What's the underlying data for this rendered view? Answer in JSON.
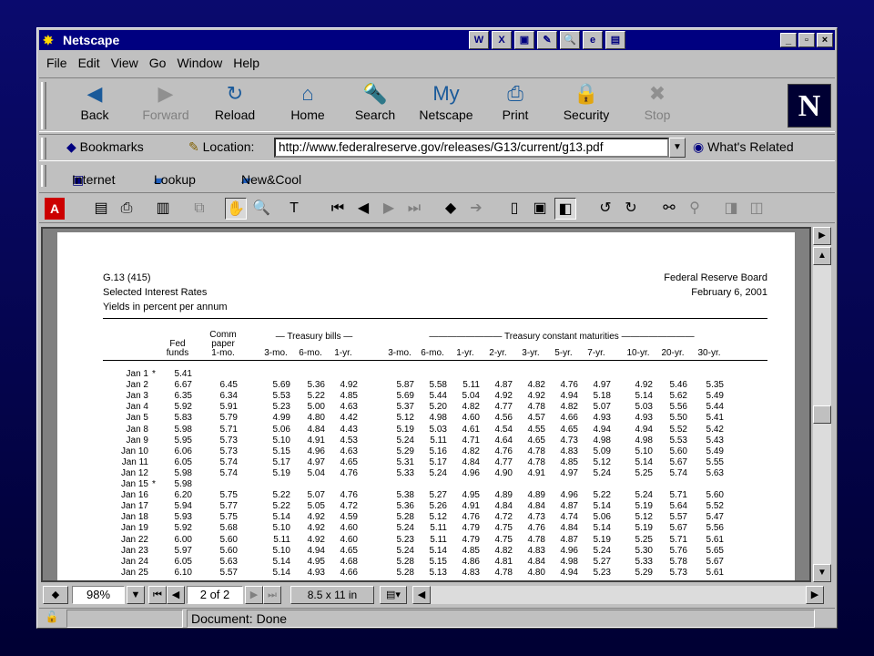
{
  "window": {
    "title": "Netscape",
    "tray_icons": [
      "W",
      "X",
      "▣",
      "✎",
      "🔍",
      "e",
      "▤"
    ],
    "buttons": [
      "_",
      "▫",
      "×"
    ]
  },
  "menu": [
    "File",
    "Edit",
    "View",
    "Go",
    "Window",
    "Help"
  ],
  "nav": [
    {
      "label": "Back",
      "icon": "◀",
      "enabled": true
    },
    {
      "label": "Forward",
      "icon": "▶",
      "enabled": false
    },
    {
      "label": "Reload",
      "icon": "↻",
      "enabled": true
    },
    {
      "label": "Home",
      "icon": "⌂",
      "enabled": true
    },
    {
      "label": "Search",
      "icon": "🔦",
      "enabled": true
    },
    {
      "label": "Netscape",
      "icon": "My",
      "enabled": true
    },
    {
      "label": "Print",
      "icon": "⎙",
      "enabled": true
    },
    {
      "label": "Security",
      "icon": "🔒",
      "enabled": true
    },
    {
      "label": "Stop",
      "icon": "✖",
      "enabled": false
    }
  ],
  "logo": "N",
  "location": {
    "bookmarks": "Bookmarks",
    "label": "Location:",
    "url": "http://www.federalreserve.gov/releases/G13/current/g13.pdf",
    "related": "What's Related"
  },
  "personal": [
    "Internet",
    "Lookup",
    "New&Cool"
  ],
  "pdf_toolbar": {
    "adobe": "A"
  },
  "doc": {
    "header_left": [
      "G.13 (415)",
      "Selected Interest Rates",
      "Yields in percent per annum"
    ],
    "header_right": [
      "Federal Reserve Board",
      "February 6, 2001"
    ],
    "group_treasury_bills": "Treasury bills",
    "group_constant": "Treasury constant maturities",
    "columns": [
      {
        "label": "Fed\nfunds"
      },
      {
        "label": "Comm\npaper\n1-mo."
      },
      {
        "label": "3-mo."
      },
      {
        "label": "6-mo."
      },
      {
        "label": "1-yr."
      },
      {
        "label": "3-mo."
      },
      {
        "label": "6-mo."
      },
      {
        "label": "1-yr."
      },
      {
        "label": "2-yr."
      },
      {
        "label": "3-yr."
      },
      {
        "label": "5-yr."
      },
      {
        "label": "7-yr."
      },
      {
        "label": "10-yr."
      },
      {
        "label": "20-yr."
      },
      {
        "label": "30-yr."
      }
    ],
    "rows": [
      {
        "date": "Jan 1",
        "star": "*",
        "v": [
          "5.41",
          "",
          "",
          "",
          "",
          "",
          "",
          "",
          "",
          "",
          "",
          "",
          "",
          "",
          ""
        ]
      },
      {
        "date": "Jan 2",
        "star": "",
        "v": [
          "6.67",
          "6.45",
          "5.69",
          "5.36",
          "4.92",
          "5.87",
          "5.58",
          "5.11",
          "4.87",
          "4.82",
          "4.76",
          "4.97",
          "4.92",
          "5.46",
          "5.35"
        ]
      },
      {
        "date": "Jan 3",
        "star": "",
        "v": [
          "6.35",
          "6.34",
          "5.53",
          "5.22",
          "4.85",
          "5.69",
          "5.44",
          "5.04",
          "4.92",
          "4.92",
          "4.94",
          "5.18",
          "5.14",
          "5.62",
          "5.49"
        ]
      },
      {
        "date": "Jan 4",
        "star": "",
        "v": [
          "5.92",
          "5.91",
          "5.23",
          "5.00",
          "4.63",
          "5.37",
          "5.20",
          "4.82",
          "4.77",
          "4.78",
          "4.82",
          "5.07",
          "5.03",
          "5.56",
          "5.44"
        ]
      },
      {
        "date": "Jan 5",
        "star": "",
        "v": [
          "5.83",
          "5.79",
          "4.99",
          "4.80",
          "4.42",
          "5.12",
          "4.98",
          "4.60",
          "4.56",
          "4.57",
          "4.66",
          "4.93",
          "4.93",
          "5.50",
          "5.41"
        ]
      },
      {
        "date": "Jan 8",
        "star": "",
        "v": [
          "5.98",
          "5.71",
          "5.06",
          "4.84",
          "4.43",
          "5.19",
          "5.03",
          "4.61",
          "4.54",
          "4.55",
          "4.65",
          "4.94",
          "4.94",
          "5.52",
          "5.42"
        ]
      },
      {
        "date": "Jan 9",
        "star": "",
        "v": [
          "5.95",
          "5.73",
          "5.10",
          "4.91",
          "4.53",
          "5.24",
          "5.11",
          "4.71",
          "4.64",
          "4.65",
          "4.73",
          "4.98",
          "4.98",
          "5.53",
          "5.43"
        ]
      },
      {
        "date": "Jan 10",
        "star": "",
        "v": [
          "6.06",
          "5.73",
          "5.15",
          "4.96",
          "4.63",
          "5.29",
          "5.16",
          "4.82",
          "4.76",
          "4.78",
          "4.83",
          "5.09",
          "5.10",
          "5.60",
          "5.49"
        ]
      },
      {
        "date": "Jan 11",
        "star": "",
        "v": [
          "6.05",
          "5.74",
          "5.17",
          "4.97",
          "4.65",
          "5.31",
          "5.17",
          "4.84",
          "4.77",
          "4.78",
          "4.85",
          "5.12",
          "5.14",
          "5.67",
          "5.55"
        ]
      },
      {
        "date": "Jan 12",
        "star": "",
        "v": [
          "5.98",
          "5.74",
          "5.19",
          "5.04",
          "4.76",
          "5.33",
          "5.24",
          "4.96",
          "4.90",
          "4.91",
          "4.97",
          "5.24",
          "5.25",
          "5.74",
          "5.63"
        ]
      },
      {
        "date": "Jan 15",
        "star": "*",
        "v": [
          "5.98",
          "",
          "",
          "",
          "",
          "",
          "",
          "",
          "",
          "",
          "",
          "",
          "",
          "",
          ""
        ]
      },
      {
        "date": "Jan 16",
        "star": "",
        "v": [
          "6.20",
          "5.75",
          "5.22",
          "5.07",
          "4.76",
          "5.38",
          "5.27",
          "4.95",
          "4.89",
          "4.89",
          "4.96",
          "5.22",
          "5.24",
          "5.71",
          "5.60"
        ]
      },
      {
        "date": "Jan 17",
        "star": "",
        "v": [
          "5.94",
          "5.77",
          "5.22",
          "5.05",
          "4.72",
          "5.36",
          "5.26",
          "4.91",
          "4.84",
          "4.84",
          "4.87",
          "5.14",
          "5.19",
          "5.64",
          "5.52"
        ]
      },
      {
        "date": "Jan 18",
        "star": "",
        "v": [
          "5.93",
          "5.75",
          "5.14",
          "4.92",
          "4.59",
          "5.28",
          "5.12",
          "4.76",
          "4.72",
          "4.73",
          "4.74",
          "5.06",
          "5.12",
          "5.57",
          "5.47"
        ]
      },
      {
        "date": "Jan 19",
        "star": "",
        "v": [
          "5.92",
          "5.68",
          "5.10",
          "4.92",
          "4.60",
          "5.24",
          "5.11",
          "4.79",
          "4.75",
          "4.76",
          "4.84",
          "5.14",
          "5.19",
          "5.67",
          "5.56"
        ]
      },
      {
        "date": "Jan 22",
        "star": "",
        "v": [
          "6.00",
          "5.60",
          "5.11",
          "4.92",
          "4.60",
          "5.23",
          "5.11",
          "4.79",
          "4.75",
          "4.78",
          "4.87",
          "5.19",
          "5.25",
          "5.71",
          "5.61"
        ]
      },
      {
        "date": "Jan 23",
        "star": "",
        "v": [
          "5.97",
          "5.60",
          "5.10",
          "4.94",
          "4.65",
          "5.24",
          "5.14",
          "4.85",
          "4.82",
          "4.83",
          "4.96",
          "5.24",
          "5.30",
          "5.76",
          "5.65"
        ]
      },
      {
        "date": "Jan 24",
        "star": "",
        "v": [
          "6.05",
          "5.63",
          "5.14",
          "4.95",
          "4.68",
          "5.28",
          "5.15",
          "4.86",
          "4.81",
          "4.84",
          "4.98",
          "5.27",
          "5.33",
          "5.78",
          "5.67"
        ]
      },
      {
        "date": "Jan 25",
        "star": "",
        "v": [
          "6.10",
          "5.57",
          "5.14",
          "4.93",
          "4.66",
          "5.28",
          "5.13",
          "4.83",
          "4.78",
          "4.80",
          "4.94",
          "5.23",
          "5.29",
          "5.73",
          "5.61"
        ]
      }
    ]
  },
  "viewer_status": {
    "zoom": "98%",
    "page": "2 of 2",
    "size": "8.5 x 11 in"
  },
  "status": {
    "message": "Document: Done"
  }
}
